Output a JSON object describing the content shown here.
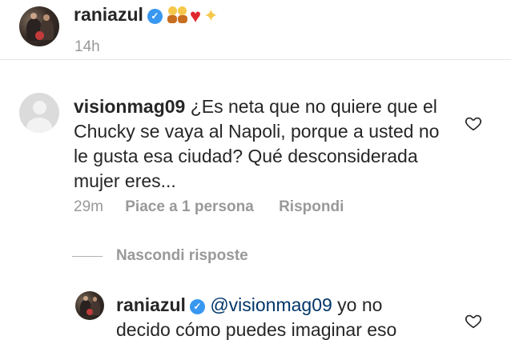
{
  "post": {
    "username": "raniazul",
    "verified_icon": "verified-badge-icon",
    "emojis": [
      "family-emoji",
      "red-heart-emoji",
      "sparkles-emoji"
    ],
    "time": "14h"
  },
  "comment": {
    "username": "visionmag09",
    "text": "¿Es neta que no quiere que el Chucky se vaya al Napoli, porque a usted no le gusta esa ciudad? Qué desconsiderada mujer eres...",
    "time": "29m",
    "likes": "Piace a 1 persona",
    "reply_label": "Rispondi",
    "hide_replies_label": "Nascondi risposte"
  },
  "reply": {
    "username": "raniazul",
    "mention": "@visionmag09",
    "text_line1": " yo no",
    "text_line2": "decido cómo puedes imaginar eso"
  },
  "colors": {
    "text": "#262626",
    "secondary": "#999999",
    "mention": "#003569",
    "verified": "#3897f0"
  }
}
